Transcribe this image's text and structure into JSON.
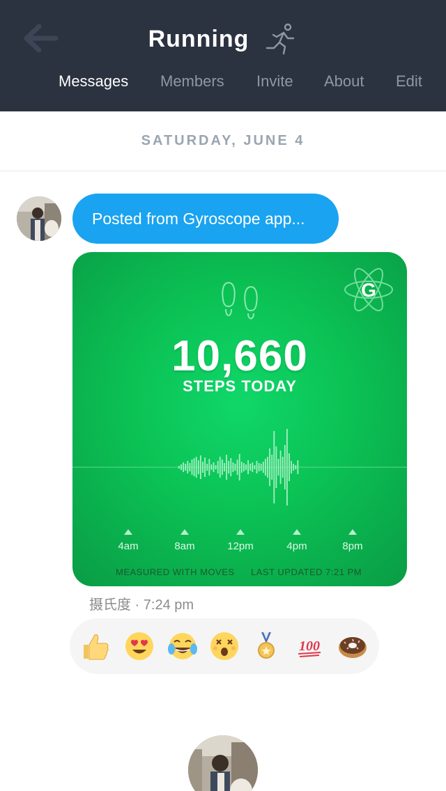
{
  "header": {
    "title": "Running",
    "tabs": [
      "Messages",
      "Members",
      "Invite",
      "About",
      "Edit"
    ],
    "active_tab": "Messages"
  },
  "date_separator": "SATURDAY, JUNE 4",
  "message": {
    "bubble_text": "Posted from Gyroscope app...",
    "card": {
      "steps_value": "10,660",
      "steps_label": "STEPS TODAY",
      "time_labels": [
        "4am",
        "8am",
        "12pm",
        "4pm",
        "8pm"
      ],
      "measured_text": "MEASURED WITH MOVES",
      "updated_text": "LAST UPDATED 7:21 PM",
      "logo_letter": "G"
    },
    "meta": "摄氏度 · 7:24 pm"
  },
  "reactions": [
    {
      "name": "thumbs-up-icon"
    },
    {
      "name": "heart-eyes-icon"
    },
    {
      "name": "tears-of-joy-icon"
    },
    {
      "name": "astonished-face-icon"
    },
    {
      "name": "sports-medal-icon"
    },
    {
      "name": "hundred-points-icon",
      "text": "100"
    },
    {
      "name": "doughnut-icon"
    }
  ],
  "colors": {
    "header_bg": "#2b3240",
    "bubble": "#1aa3f0",
    "card_green": "#0bc154",
    "date_text": "#9aa5b1"
  }
}
